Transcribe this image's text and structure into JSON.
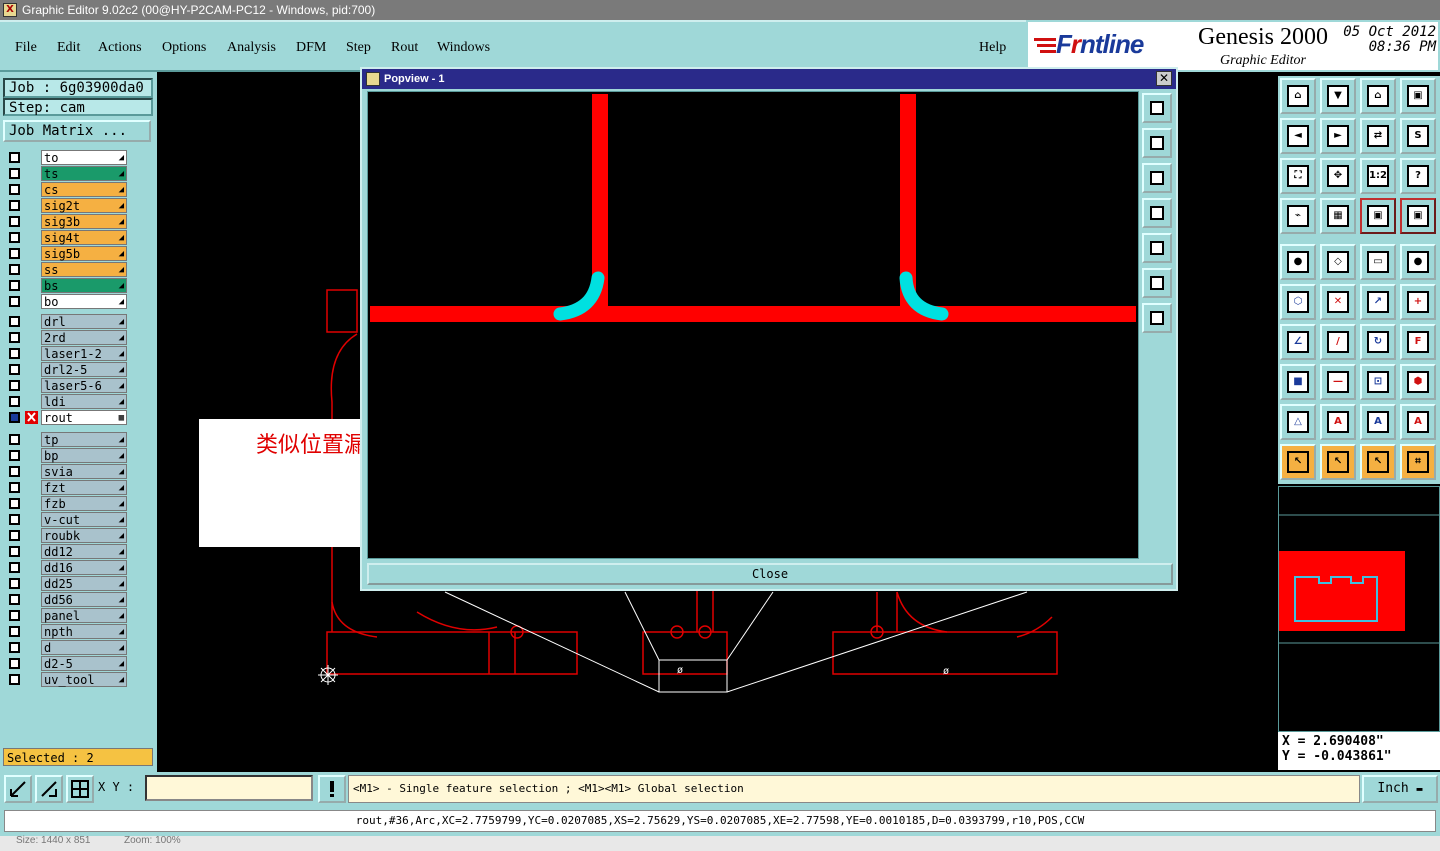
{
  "window": {
    "title": "Graphic Editor 9.02c2 (00@HY-P2CAM-PC12 - Windows, pid:700)"
  },
  "menu": {
    "file": "File",
    "edit": "Edit",
    "actions": "Actions",
    "options": "Options",
    "analysis": "Analysis",
    "dfm": "DFM",
    "step": "Step",
    "rout": "Rout",
    "windows": "Windows",
    "help": "Help"
  },
  "brand": {
    "logo_a": "F",
    "logo_b": "r",
    "logo_c": "ntline",
    "product": "Genesis 2000",
    "subtitle": "Graphic Editor",
    "date": "05 Oct 2012",
    "time": "08:36 PM"
  },
  "job": {
    "job_label": "Job : 6g03900da0",
    "step_label": "Step: cam",
    "matrix_button": "Job Matrix ..."
  },
  "layers_group1": [
    {
      "name": "to",
      "color": "#ffffff"
    },
    {
      "name": "ts",
      "color": "#1a9a6a"
    },
    {
      "name": "cs",
      "color": "#f5b042"
    },
    {
      "name": "sig2t",
      "color": "#f5b042"
    },
    {
      "name": "sig3b",
      "color": "#f5b042"
    },
    {
      "name": "sig4t",
      "color": "#f5b042"
    },
    {
      "name": "sig5b",
      "color": "#f5b042"
    },
    {
      "name": "ss",
      "color": "#f5b042"
    },
    {
      "name": "bs",
      "color": "#1a9a6a"
    },
    {
      "name": "bo",
      "color": "#ffffff"
    }
  ],
  "layers_group2": [
    {
      "name": "drl",
      "color": "#a9c2cc"
    },
    {
      "name": "2rd",
      "color": "#a9c2cc"
    },
    {
      "name": "laser1-2",
      "color": "#a9c2cc"
    },
    {
      "name": "drl2-5",
      "color": "#a9c2cc"
    },
    {
      "name": "laser5-6",
      "color": "#a9c2cc"
    },
    {
      "name": "ldi",
      "color": "#a9c2cc"
    },
    {
      "name": "rout",
      "color": "#ffffff"
    }
  ],
  "layers_group3": [
    {
      "name": "tp",
      "color": "#a9c2cc"
    },
    {
      "name": "bp",
      "color": "#a9c2cc"
    },
    {
      "name": "svia",
      "color": "#a9c2cc"
    },
    {
      "name": "fzt",
      "color": "#a9c2cc"
    },
    {
      "name": "fzb",
      "color": "#a9c2cc"
    },
    {
      "name": "v-cut",
      "color": "#a9c2cc"
    },
    {
      "name": "roubk",
      "color": "#a9c2cc"
    },
    {
      "name": "dd12",
      "color": "#a9c2cc"
    },
    {
      "name": "dd16",
      "color": "#a9c2cc"
    },
    {
      "name": "dd25",
      "color": "#a9c2cc"
    },
    {
      "name": "dd56",
      "color": "#a9c2cc"
    },
    {
      "name": "panel",
      "color": "#a9c2cc"
    },
    {
      "name": "npth",
      "color": "#a9c2cc"
    },
    {
      "name": "d",
      "color": "#a9c2cc"
    },
    {
      "name": "d2-5",
      "color": "#a9c2cc"
    },
    {
      "name": "uv_tool",
      "color": "#a9c2cc"
    }
  ],
  "selected": {
    "label": "Selected : 2"
  },
  "popup": {
    "title": "Popview - 1",
    "close_label": "Close",
    "close_x": "✕"
  },
  "annotation": {
    "text": "类似位置漏做铣刀位"
  },
  "coords": {
    "x": "X = 2.690408\"",
    "y": "Y = -0.043861\""
  },
  "bottom": {
    "xy_label": "X Y :",
    "message": "<M1> - Single feature selection ; <M1><M1> Global selection",
    "unit": "Inch"
  },
  "status": {
    "text": "rout,#36,Arc,XC=2.7759799,YC=0.0207085,XS=2.75629,YS=0.0207085,XE=2.77598,YE=0.0010185,D=0.0393799,r10,POS,CCW"
  },
  "footer": {
    "size": "Size: 1440 x 851",
    "zoom": "Zoom: 100%"
  },
  "colors": {
    "panel": "#9fd8d8",
    "feature": "#ff0000",
    "highlight": "#00e0e0",
    "canvas": "#000000"
  },
  "icons": [
    "layer-checkbox",
    "tool-icon",
    "close-icon",
    "warning-icon",
    "compass-icon"
  ]
}
